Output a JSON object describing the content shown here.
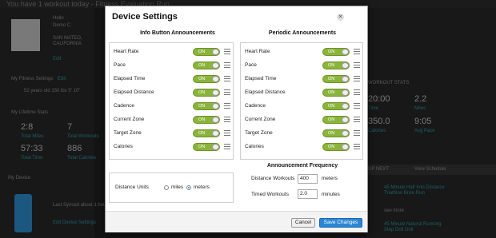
{
  "background": {
    "top_title": "You have 1 workout today - Fitness Evaluation Run",
    "greeting": "Hello",
    "user_name": "Demo C",
    "location_line1": "SAN MATEO,",
    "location_line2": "CALIFORNIA",
    "edit_link": "Edit",
    "fitness_settings_label": "My Fitness Settings",
    "fitness_settings_edit": "Edit",
    "fitness_settings_value": "52 years old  150 lbs  5' 10\"",
    "lifetime_stats_label": "My Lifetime Stats",
    "stats": [
      {
        "value": "2:8",
        "label": "Total Miles"
      },
      {
        "value": "7",
        "label": "Total Workouts"
      },
      {
        "value": "57:33",
        "label": "Total Time"
      },
      {
        "value": "886",
        "label": "Total Calories"
      }
    ],
    "device_label": "My Device",
    "device_text": "Last Synced about 1 hour ago",
    "device_settings_link": "Edit Device Settings",
    "workout_stats_label": "WORKOUT STATS",
    "workout_stats": [
      {
        "value": "20:00",
        "label": "Time"
      },
      {
        "value": "2.2",
        "label": "Miles"
      },
      {
        "value": "350.0",
        "label": "Calories"
      },
      {
        "value": "9:05",
        "label": "Avg Pace"
      }
    ],
    "up_next_label": "UP NEXT",
    "view_schedule": "View Schedule",
    "up_next_items": [
      {
        "title": "45 Minute Half Iron Distance Triathlon Brick Run",
        "link": "see more"
      },
      {
        "title": "45 Minute Natural Running Step Drill Drill",
        "link": ""
      }
    ],
    "brand_color": "#2b86c5",
    "accent_color": "#2a8f9a"
  },
  "modal": {
    "title": "Device Settings",
    "close_icon": "close-icon",
    "info_title": "Info Button Announcements",
    "periodic_title": "Periodic Announcements",
    "toggle_label": "ON",
    "toggle_color": "#8ab43b",
    "info_rows": [
      {
        "label": "Heart Rate",
        "state": "ON"
      },
      {
        "label": "Pace",
        "state": "ON"
      },
      {
        "label": "Elapsed Time",
        "state": "ON"
      },
      {
        "label": "Elapsed Distance",
        "state": "ON"
      },
      {
        "label": "Cadence",
        "state": "ON"
      },
      {
        "label": "Current Zone",
        "state": "ON"
      },
      {
        "label": "Target Zone",
        "state": "ON"
      },
      {
        "label": "Calories",
        "state": "ON"
      }
    ],
    "periodic_rows": [
      {
        "label": "Heart Rate",
        "state": "ON"
      },
      {
        "label": "Pace",
        "state": "ON"
      },
      {
        "label": "Elapsed Time",
        "state": "ON"
      },
      {
        "label": "Elapsed Distance",
        "state": "ON"
      },
      {
        "label": "Cadence",
        "state": "ON"
      },
      {
        "label": "Current Zone",
        "state": "ON"
      },
      {
        "label": "Target Zone",
        "state": "ON"
      },
      {
        "label": "Calories",
        "state": "ON"
      }
    ],
    "distance_units_label": "Distance Units",
    "unit_miles": "miles",
    "unit_meters": "meters",
    "selected_unit": "meters",
    "frequency_title": "Announcement Frequency",
    "distance_workouts_label": "Distance Workouts",
    "distance_workouts_value": "400",
    "distance_workouts_unit": "meters",
    "timed_workouts_label": "Timed Workouts",
    "timed_workouts_value": "2.0",
    "timed_workouts_unit": "minutes",
    "cancel_label": "Cancel",
    "save_label": "Save Changes",
    "save_color": "#2b86d5"
  }
}
